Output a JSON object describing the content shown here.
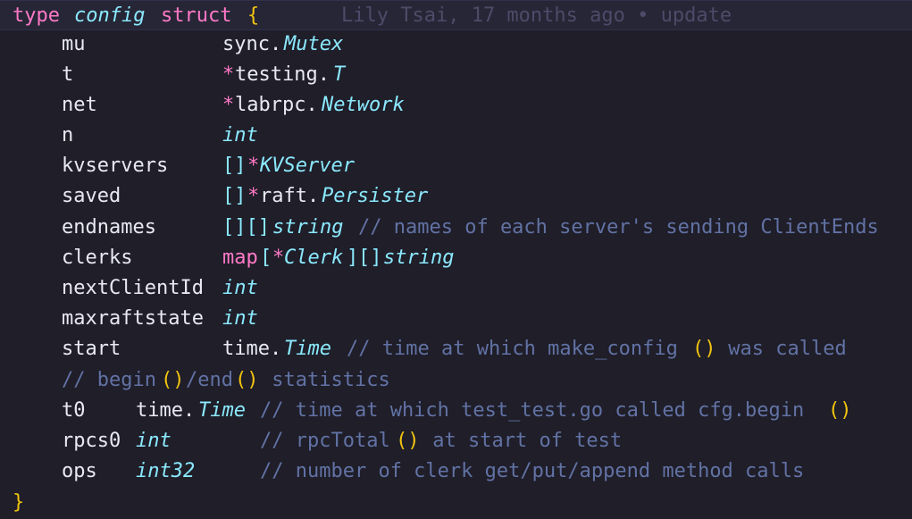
{
  "header": {
    "kw_type": "type",
    "name": "config",
    "kw_struct": "struct",
    "brace_open": "{",
    "blame": "Lily Tsai, 17 months ago • update"
  },
  "fields": [
    {
      "name": "mu",
      "pkg": "sync.",
      "type": "Mutex"
    },
    {
      "name": "t",
      "ptr": "*",
      "pkg": "testing.",
      "type": "T"
    },
    {
      "name": "net",
      "ptr": "*",
      "pkg": "labrpc.",
      "type": "Network"
    },
    {
      "name": "n",
      "type": "int"
    },
    {
      "name": "kvservers",
      "br": "[]",
      "ptr": "*",
      "type": "KVServer"
    },
    {
      "name": "saved",
      "br": "[]",
      "ptr": "*",
      "pkg": "raft.",
      "type": "Persister"
    },
    {
      "name": "endnames",
      "br": "[][]",
      "type": "string",
      "comment": "// names of each server's sending ClientEnds"
    },
    {
      "name": "clerks",
      "map": "map",
      "lb": "[",
      "ptr": "*",
      "type": "Clerk",
      "rb": "]",
      "br": "[]",
      "type2": "string"
    },
    {
      "name": "nextClientId",
      "type": "int"
    },
    {
      "name": "maxraftstate",
      "type": "int"
    },
    {
      "name": "start",
      "pkg": "time.",
      "type": "Time",
      "comment1": "// time at which make_config",
      "paren": "()",
      "comment2": " was called"
    }
  ],
  "section_comment": {
    "a": "// begin",
    "p1": "()",
    "b": "/end",
    "p2": "()",
    "c": " statistics"
  },
  "stats": [
    {
      "name": "t0",
      "pkg": "time.",
      "type": "Time",
      "comment1": "// time at which test_test.go called cfg.begin",
      "paren": "()"
    },
    {
      "name": "rpcs0",
      "type": "int",
      "comment1": "// rpcTotal",
      "paren": "()",
      "comment2": " at start of test"
    },
    {
      "name": "ops",
      "type": "int32",
      "comment1": "// number of clerk get/put/append method calls"
    }
  ],
  "closing": "}"
}
